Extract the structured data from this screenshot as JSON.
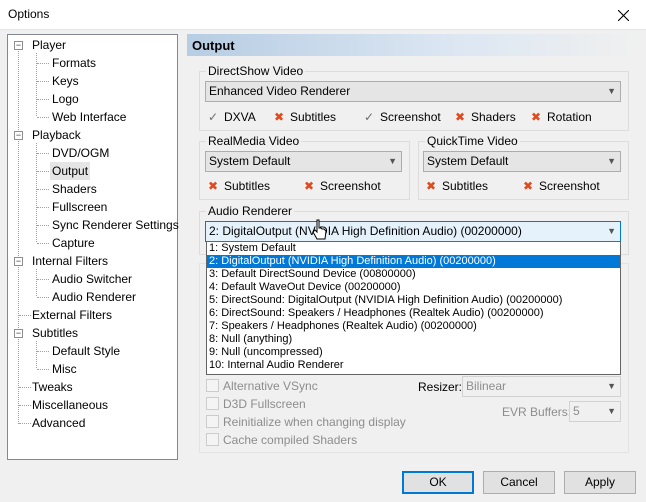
{
  "window": {
    "title": "Options"
  },
  "tree": [
    {
      "label": "Player",
      "expander": "−"
    },
    {
      "label": "Formats"
    },
    {
      "label": "Keys"
    },
    {
      "label": "Logo"
    },
    {
      "label": "Web Interface"
    },
    {
      "label": "Playback",
      "expander": "−"
    },
    {
      "label": "DVD/OGM"
    },
    {
      "label": "Output",
      "selected": true
    },
    {
      "label": "Shaders"
    },
    {
      "label": "Fullscreen"
    },
    {
      "label": "Sync Renderer Settings"
    },
    {
      "label": "Capture"
    },
    {
      "label": "Internal Filters",
      "expander": "−"
    },
    {
      "label": "Audio Switcher"
    },
    {
      "label": "Audio Renderer"
    },
    {
      "label": "External Filters"
    },
    {
      "label": "Subtitles",
      "expander": "−"
    },
    {
      "label": "Default Style"
    },
    {
      "label": "Misc"
    },
    {
      "label": "Tweaks"
    },
    {
      "label": "Miscellaneous"
    },
    {
      "label": "Advanced"
    }
  ],
  "page": {
    "title": "Output",
    "directshow": {
      "legend": "DirectShow Video",
      "value": "Enhanced Video Renderer",
      "caps": [
        {
          "label": "DXVA",
          "ok": true
        },
        {
          "label": "Subtitles",
          "ok": false
        },
        {
          "label": "Screenshot",
          "ok": true
        },
        {
          "label": "Shaders",
          "ok": false
        },
        {
          "label": "Rotation",
          "ok": false
        }
      ]
    },
    "realmedia": {
      "legend": "RealMedia Video",
      "value": "System Default",
      "caps": [
        {
          "label": "Subtitles"
        },
        {
          "label": "Screenshot"
        }
      ]
    },
    "quicktime": {
      "legend": "QuickTime Video",
      "value": "System Default",
      "caps": [
        {
          "label": "Subtitles"
        },
        {
          "label": "Screenshot"
        }
      ]
    },
    "audio": {
      "legend": "Audio Renderer",
      "value": "2: DigitalOutput (NVIDIA High Definition Audio) (00200000)",
      "options": [
        "1: System Default",
        "2: DigitalOutput (NVIDIA High Definition Audio) (00200000)",
        "3: Default DirectSound Device (00800000)",
        "4: Default WaveOut Device (00200000)",
        "5: DirectSound: DigitalOutput (NVIDIA High Definition Audio) (00200000)",
        "6: DirectSound: Speakers / Headphones (Realtek Audio) (00200000)",
        "7: Speakers / Headphones (Realtek Audio) (00200000)",
        "8: Null (anything)",
        "9: Null (uncompressed)",
        "10: Internal Audio Renderer"
      ],
      "highlighted_index": 1
    },
    "options": {
      "alt_vsync": "Alternative VSync",
      "d3d_fullscreen": "D3D Fullscreen",
      "reinit": "Reinitialize when changing display",
      "cache_shaders": "Cache compiled Shaders",
      "resizer_label": "Resizer:",
      "resizer_value": "Bilinear",
      "evr_label": "EVR Buffers:",
      "evr_value": "5"
    }
  },
  "buttons": {
    "ok": "OK",
    "cancel": "Cancel",
    "apply": "Apply"
  }
}
